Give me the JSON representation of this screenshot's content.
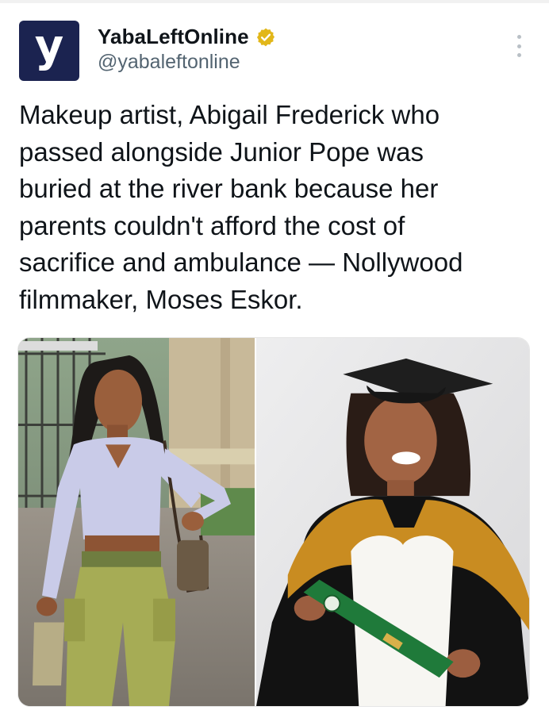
{
  "post": {
    "author": {
      "display_name": "YabaLeftOnline",
      "handle": "@yabaleftonline",
      "avatar_letter": "y",
      "avatar_color": "#1b2350",
      "verified_color": "#e2b719",
      "verified_icon": "verified-badge-icon"
    },
    "menu_icon": "more-vertical-icon",
    "text": "Makeup artist, Abigail Frederick who\npassed alongside Junior Pope was\nburied at the river bank because her\nparents couldn't afford the cost of\nsacrifice and ambulance — Nollywood\nfilmmaker, Moses Eskor.",
    "media": {
      "count": 2,
      "left_photo": "woman-in-lilac-top-and-green-cargo-trousers-photo",
      "right_photo": "woman-in-graduation-gown-and-cap-photo"
    }
  },
  "colors": {
    "text_primary": "#0f1419",
    "text_secondary": "#536471"
  }
}
